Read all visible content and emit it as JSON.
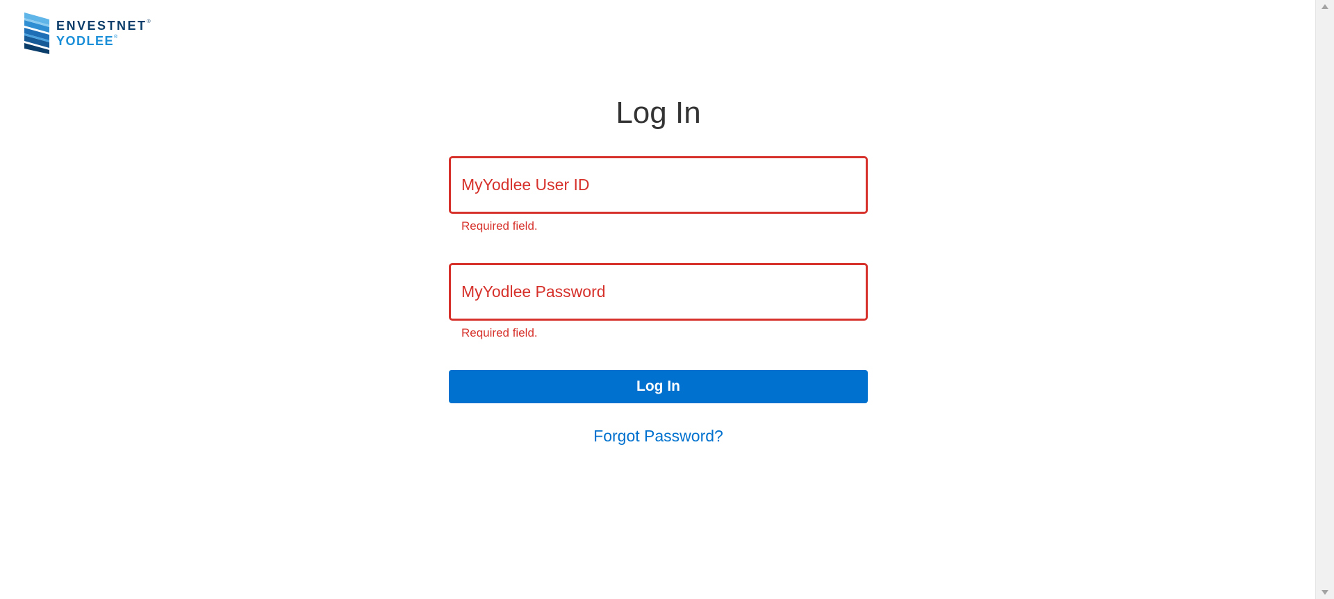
{
  "logo": {
    "line1": "ENVESTNET",
    "line2": "YODLEE",
    "mark_icon": "envestnet-yodlee-logo-icon",
    "colors": {
      "dark": "#0b3d6b",
      "light": "#1a8fd8"
    }
  },
  "login": {
    "title": "Log In",
    "user_id": {
      "placeholder": "MyYodlee User ID",
      "value": "",
      "error": "Required field."
    },
    "password": {
      "placeholder": "MyYodlee Password",
      "value": "",
      "error": "Required field."
    },
    "submit_label": "Log In",
    "forgot_label": "Forgot Password?"
  },
  "colors": {
    "error": "#d6312b",
    "primary": "#0071ce",
    "title": "#333333"
  }
}
